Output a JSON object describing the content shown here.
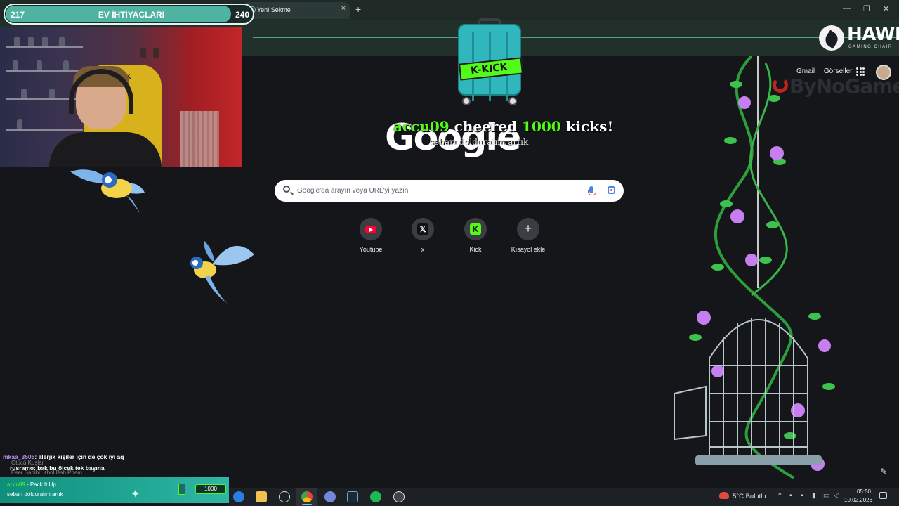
{
  "browser": {
    "tab_title": "Yeni Sekme",
    "new_tab_label": "+",
    "tab_close_label": "×",
    "window_controls": {
      "minimize": "—",
      "restore": "❐",
      "close": "✕"
    }
  },
  "stream_overlay": {
    "goal": {
      "current": "217",
      "title": "EV İHTİYACLARI",
      "target": "240",
      "progress": 0.904
    },
    "hawk_logo": {
      "text": "HAWK",
      "subtext": "GAMING CHAIR"
    },
    "sponsor": "ByNoGame",
    "cheer": {
      "user": "accu09",
      "verb": "cheered",
      "amount": "1000",
      "unit": "kicks!",
      "message": "sebarı dolduralım artık"
    },
    "chair_logo": "HAWK",
    "chat": [
      {
        "user": "mkaa_3506",
        "text": ": alerjik kişiler için de çok iyi aq"
      },
      {
        "user": "rusramo",
        "text": ": bak bu ölcek tek başına"
      }
    ],
    "chat_ghost": [
      "Ötücü Kuşlar",
      "Eser Sahibi: Khol Bab Pham"
    ],
    "kick_alert": {
      "user": "accu09",
      "action": "- Pack It Up",
      "message": "sebarı dolduralım artık",
      "badge": "1000"
    },
    "suitcase_label": "K-KICK"
  },
  "google": {
    "logo": "Google",
    "top_links": {
      "gmail": "Gmail",
      "images": "Görseller"
    },
    "search": {
      "placeholder": "Google'da arayın veya URL'yi yazın"
    },
    "shortcuts": [
      {
        "label": "Youtube",
        "icon": "youtube-icon"
      },
      {
        "label": "x",
        "icon": "x-icon"
      },
      {
        "label": "Kick",
        "icon": "kick-icon"
      },
      {
        "label": "Kısayol ekle",
        "icon": "plus-icon"
      }
    ],
    "customize_icon": "pencil-icon"
  },
  "taskbar": {
    "weather": "5°C Bulutlu",
    "time": "05:50",
    "date": "10.02.2026",
    "apps": [
      "edge-icon",
      "file-explorer-icon",
      "snipping-icon",
      "chrome-icon",
      "discord-icon",
      "steam-icon",
      "spotify-icon",
      "obs-icon"
    ]
  },
  "colors": {
    "kick_green": "#53fc18",
    "goal_fill": "#4fb3a2",
    "page_bg": "#14161a"
  }
}
